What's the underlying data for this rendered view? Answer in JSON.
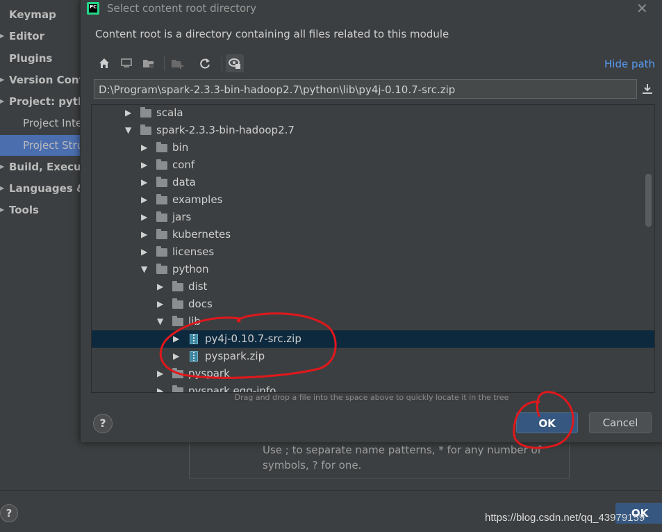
{
  "settings": {
    "sidebar": [
      {
        "label": "Keymap",
        "arrow": false
      },
      {
        "label": "Editor",
        "arrow": true
      },
      {
        "label": "Plugins",
        "arrow": false
      },
      {
        "label": "Version Control",
        "arrow": true
      },
      {
        "label": "Project: python",
        "arrow": true
      },
      {
        "label": "Project Interpreter",
        "arrow": false
      },
      {
        "label": "Project Structure",
        "arrow": false,
        "selected": true
      },
      {
        "label": "Build, Execution, Deployment",
        "arrow": true
      },
      {
        "label": "Languages & Frameworks",
        "arrow": true
      },
      {
        "label": "Tools",
        "arrow": true
      }
    ],
    "hint_line1": "Use ; to separate name patterns, * for any number of",
    "hint_line2": "symbols, ? for one.",
    "help_glyph": "?",
    "ok_label": "OK"
  },
  "dialog": {
    "app_icon_text": "PC",
    "title": "Select content root directory",
    "close_glyph": "✕",
    "description": "Content root is a directory containing all files related to this module",
    "hide_path": "Hide path",
    "path": "D:\\Program\\spark-2.3.3-bin-hadoop2.7\\python\\lib\\py4j-0.10.7-src.zip",
    "toolbar": [
      "home-icon",
      "desktop-icon",
      "project-folder-icon",
      "new-folder-icon",
      "refresh-icon",
      "show-hidden-icon"
    ],
    "tree": [
      {
        "name": "scala",
        "level": 0,
        "expanded": false,
        "type": "folder"
      },
      {
        "name": "spark-2.3.3-bin-hadoop2.7",
        "level": 0,
        "expanded": true,
        "type": "folder"
      },
      {
        "name": "bin",
        "level": 1,
        "expanded": false,
        "type": "folder"
      },
      {
        "name": "conf",
        "level": 1,
        "expanded": false,
        "type": "folder"
      },
      {
        "name": "data",
        "level": 1,
        "expanded": false,
        "type": "folder"
      },
      {
        "name": "examples",
        "level": 1,
        "expanded": false,
        "type": "folder"
      },
      {
        "name": "jars",
        "level": 1,
        "expanded": false,
        "type": "folder"
      },
      {
        "name": "kubernetes",
        "level": 1,
        "expanded": false,
        "type": "folder"
      },
      {
        "name": "licenses",
        "level": 1,
        "expanded": false,
        "type": "folder"
      },
      {
        "name": "python",
        "level": 1,
        "expanded": true,
        "type": "folder"
      },
      {
        "name": "dist",
        "level": 2,
        "expanded": false,
        "type": "folder"
      },
      {
        "name": "docs",
        "level": 2,
        "expanded": false,
        "type": "folder"
      },
      {
        "name": "lib",
        "level": 2,
        "expanded": true,
        "type": "folder"
      },
      {
        "name": "py4j-0.10.7-src.zip",
        "level": 3,
        "expanded": false,
        "type": "zip",
        "selected": true
      },
      {
        "name": "pyspark.zip",
        "level": 3,
        "expanded": false,
        "type": "zip"
      },
      {
        "name": "pyspark",
        "level": 2,
        "expanded": false,
        "type": "folder"
      },
      {
        "name": "pyspark.egg-info",
        "level": 2,
        "expanded": false,
        "type": "folder"
      }
    ],
    "drag_hint": "Drag and drop a file into the space above to quickly locate it in the tree",
    "help_glyph": "?",
    "ok_label": "OK",
    "cancel_label": "Cancel"
  },
  "watermark": "https://blog.csdn.net/qq_43979159",
  "colors": {
    "accent": "#589df6",
    "ok_button": "#365880",
    "selection": "#0d293e",
    "annotation": "#e0181c"
  }
}
